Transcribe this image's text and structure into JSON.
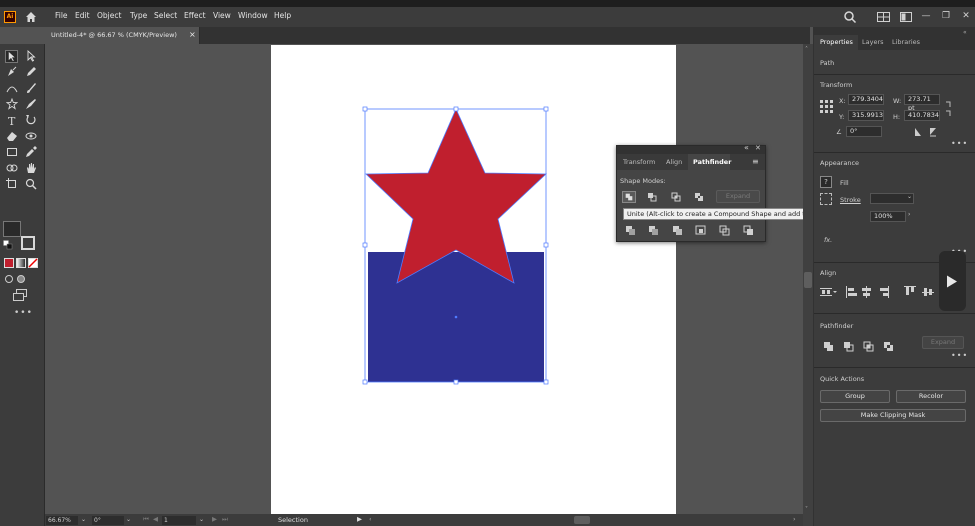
{
  "app": {
    "logo_text": "Ai"
  },
  "menu": [
    "File",
    "Edit",
    "Object",
    "Type",
    "Select",
    "Effect",
    "View",
    "Window",
    "Help"
  ],
  "document_tab": {
    "title": "Untitled-4* @ 66.67 % (CMYK/Preview)",
    "close": "×"
  },
  "window_controls": {
    "minimize": "—",
    "restore": "❐",
    "close": "✕"
  },
  "status_bar": {
    "zoom": "66.67%",
    "rotation": "0°",
    "artboard": "1",
    "tool": "Selection"
  },
  "pathfinder_panel": {
    "tabs": [
      "Transform",
      "Align",
      "Pathfinder"
    ],
    "active_tab": "Pathfinder",
    "shape_modes_label": "Shape Modes:",
    "expand_label": "Expand",
    "tooltip": "Unite (Alt-click to create a Compound Shape and add to shape area)"
  },
  "properties": {
    "tabs": [
      "Properties",
      "Layers",
      "Libraries"
    ],
    "active_tab": "Properties",
    "selection_type": "Path",
    "transform": {
      "label": "Transform",
      "x_label": "X:",
      "x": "279.3404",
      "y_label": "Y:",
      "y": "315.9913",
      "w_label": "W:",
      "w": "273.71 pt",
      "h_label": "H:",
      "h": "410.7834",
      "angle_label": "∠",
      "angle": "0°"
    },
    "appearance": {
      "label": "Appearance",
      "fill": "Fill",
      "stroke": "Stroke",
      "opacity": "100%",
      "fx": "fx."
    },
    "align": {
      "label": "Align"
    },
    "pathfinder": {
      "label": "Pathfinder",
      "expand": "Expand"
    },
    "quick_actions": {
      "label": "Quick Actions",
      "group": "Group",
      "recolor": "Recolor",
      "clipping_mask": "Make Clipping Mask"
    }
  },
  "colors": {
    "star_fill": "#c01f2e",
    "rect_fill": "#2e3192",
    "selection": "#4f7bff",
    "accent": "#ff9a00"
  }
}
